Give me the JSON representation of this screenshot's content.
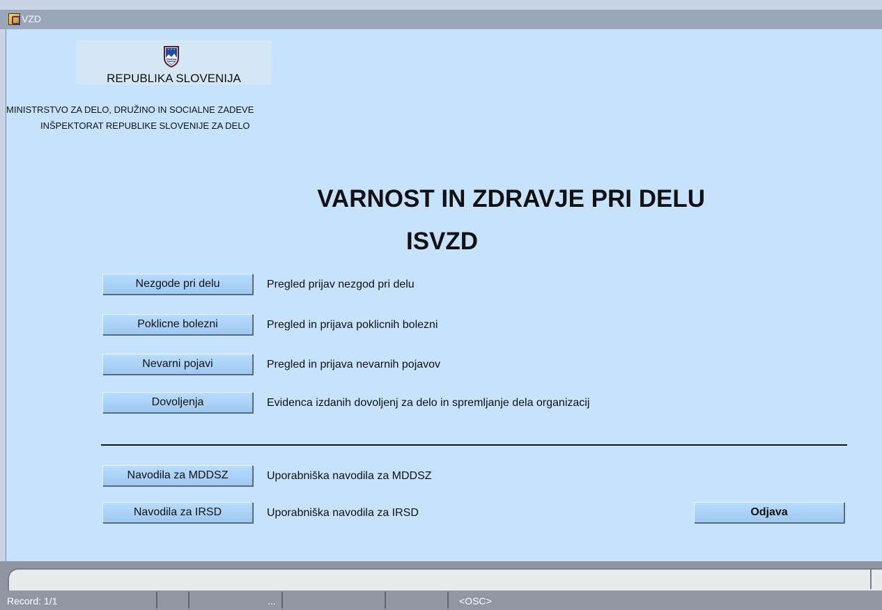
{
  "window": {
    "title": "VZD"
  },
  "header": {
    "country": "REPUBLIKA SLOVENIJA",
    "ministry": "MINISTRSTVO ZA DELO, DRUŽINO IN SOCIALNE ZADEVE",
    "inspectorate": "INŠPEKTORAT REPUBLIKE SLOVENIJE ZA DELO",
    "main_title": "VARNOST IN ZDRAVJE PRI DELU",
    "subtitle": "ISVZD"
  },
  "menu": [
    {
      "label": "Nezgode pri delu",
      "description": "Pregled prijav nezgod pri delu"
    },
    {
      "label": "Poklicne bolezni",
      "description": "Pregled in prijava poklicnih bolezni"
    },
    {
      "label": "Nevarni pojavi",
      "description": "Pregled in prijava nevarnih pojavov"
    },
    {
      "label": "Dovoljenja",
      "description": "Evidenca izdanih dovoljenj za delo in spremljanje dela organizacij"
    }
  ],
  "guides": [
    {
      "label": "Navodila za MDDSZ",
      "description": "Uporabniška navodila za MDDSZ"
    },
    {
      "label": "Navodila za IRSD",
      "description": "Uporabniška navodila za IRSD"
    }
  ],
  "logout": {
    "label": "Odjava"
  },
  "status": {
    "record": "Record: 1/1",
    "ellipsis": "...",
    "osc": "<OSC>"
  },
  "colors": {
    "content_background": "#c6e2fc",
    "button_background": "#a9d2f9",
    "title_bar": "#9aa6ba",
    "status_bar": "#8f95a1"
  },
  "icons": {
    "application": "app-icon",
    "crest": "coat-of-arms-icon"
  }
}
